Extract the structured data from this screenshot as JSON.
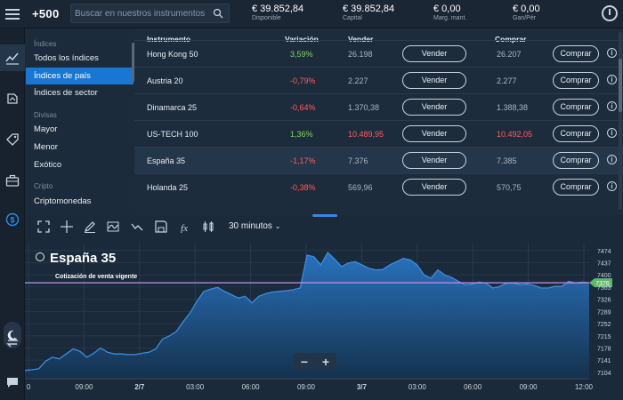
{
  "topbar": {
    "logo": "+500",
    "search_placeholder": "Buscar en nuestros instrumentos",
    "stats": [
      {
        "value": "€ 39.852,84",
        "label": "Disponible"
      },
      {
        "value": "€ 39.852,84",
        "label": "Capital"
      },
      {
        "value": "€ 0,00",
        "label": "Marg. mant."
      },
      {
        "value": "€ 0,00",
        "label": "Gan/Pér"
      }
    ]
  },
  "categories": {
    "groups": [
      {
        "title": "Índices",
        "items": [
          "Todos los índices",
          "Índices de país",
          "Índices de sector"
        ]
      },
      {
        "title": "Divisas",
        "items": [
          "Mayor",
          "Menor",
          "Exótico"
        ]
      },
      {
        "title": "Cripto",
        "items": [
          "Criptomonedas"
        ]
      }
    ],
    "selected": "Índices de país"
  },
  "table": {
    "headers": {
      "instrument": "Instrumento",
      "change": "Variación",
      "sell": "Vender",
      "buy": "Comprar"
    },
    "rows": [
      {
        "instrument": "Hong Kong 50",
        "change": "3,59%",
        "sell": "26.198",
        "buy": "26.207",
        "sell_label": "Vender",
        "buy_label": "Comprar",
        "trend": "up",
        "price_color": "muted"
      },
      {
        "instrument": "Austria 20",
        "change": "-0,79%",
        "sell": "2.227",
        "buy": "2.277",
        "sell_label": "Vender",
        "buy_label": "Comprar",
        "trend": "down",
        "price_color": "muted"
      },
      {
        "instrument": "Dinamarca 25",
        "change": "-0,64%",
        "sell": "1.370,38",
        "buy": "1.388,38",
        "sell_label": "Vender",
        "buy_label": "Comprar",
        "trend": "down",
        "price_color": "muted"
      },
      {
        "instrument": "US-TECH 100",
        "change": "1,36%",
        "sell": "10.489,95",
        "buy": "10.492,05",
        "sell_label": "Vender",
        "buy_label": "Comprar",
        "trend": "up",
        "price_color": "red"
      },
      {
        "instrument": "España 35",
        "change": "-1,17%",
        "sell": "7.376",
        "buy": "7.385",
        "sell_label": "Vender",
        "buy_label": "Comprar",
        "trend": "down",
        "price_color": "muted"
      },
      {
        "instrument": "Holanda 25",
        "change": "-0,38%",
        "sell": "569,96",
        "buy": "570,75",
        "sell_label": "Vender",
        "buy_label": "Comprar",
        "trend": "down",
        "price_color": "muted"
      }
    ],
    "highlighted_row": "España 35"
  },
  "chart_toolbar": {
    "timeframe": "30 minutos",
    "tools": [
      "expand-icon",
      "crosshair-icon",
      "pencil-icon",
      "wave-icon",
      "trend-icon",
      "save-icon",
      "fx-icon",
      "candle-icon"
    ]
  },
  "chart_data": {
    "type": "area",
    "title": "España 35",
    "annotation": "Cotización de venta vigente",
    "current_price": "7376",
    "current_value": 7376,
    "y_ticks": [
      "7474",
      "7437",
      "7400",
      "7363",
      "7326",
      "7289",
      "7252",
      "7215",
      "7178",
      "7141",
      "7104"
    ],
    "ylim": [
      7085,
      7495
    ],
    "x_ticks": [
      "0",
      "09:00",
      "2/7",
      "03:00",
      "06:00",
      "09:00",
      "3/7",
      "03:00",
      "06:00",
      "09:00",
      "12:00"
    ],
    "x_ticks_bold": [
      "2/7",
      "3/7"
    ],
    "values": [
      7110,
      7112,
      7115,
      7138,
      7150,
      7145,
      7160,
      7175,
      7168,
      7150,
      7162,
      7178,
      7165,
      7160,
      7160,
      7158,
      7158,
      7162,
      7165,
      7175,
      7205,
      7215,
      7228,
      7258,
      7285,
      7320,
      7350,
      7357,
      7362,
      7350,
      7340,
      7330,
      7335,
      7315,
      7335,
      7343,
      7348,
      7350,
      7352,
      7355,
      7360,
      7460,
      7455,
      7430,
      7468,
      7448,
      7425,
      7436,
      7440,
      7430,
      7420,
      7415,
      7416,
      7430,
      7440,
      7450,
      7445,
      7430,
      7400,
      7390,
      7415,
      7400,
      7392,
      7380,
      7370,
      7372,
      7378,
      7375,
      7360,
      7365,
      7375,
      7375,
      7370,
      7372,
      7368,
      7360,
      7360,
      7365,
      7365,
      7380,
      7376,
      7378,
      7376
    ],
    "grid": true,
    "colors": {
      "line": "#3a8de0",
      "fill_top": "#2a76c4",
      "fill_bottom": "#15324f",
      "price_line": "#c98cf0",
      "price_tag": "#5fb86a"
    }
  }
}
